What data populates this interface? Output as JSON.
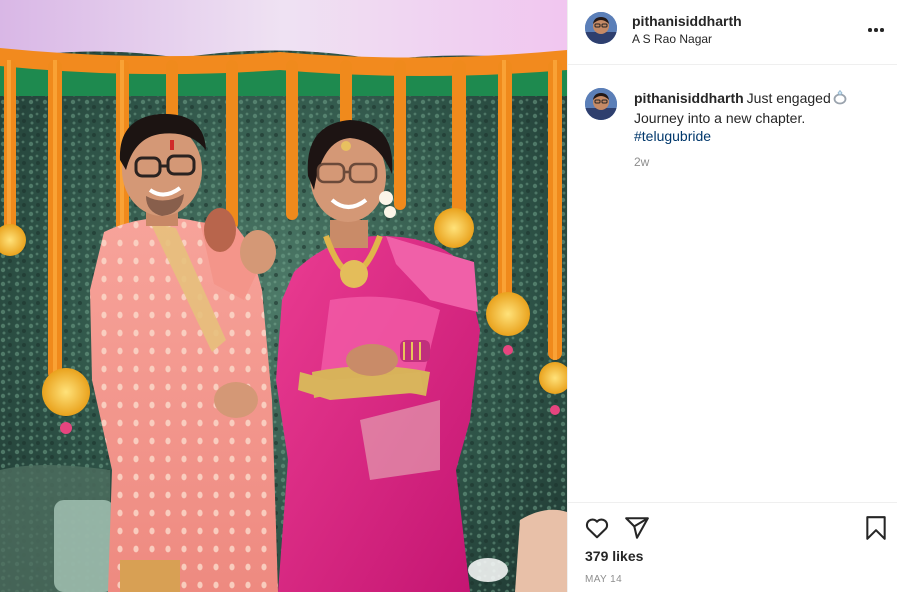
{
  "post": {
    "username": "pithanisiddharth",
    "location": "A S Rao Nagar",
    "caption_line1": "Just engaged",
    "caption_line2": "Journey into a new chapter.",
    "hashtag": "#telugubride",
    "age": "2w",
    "likes": "379 likes",
    "date": "MAY 14"
  },
  "icons": {
    "more": "more-options-icon",
    "ring": "ring-emoji-icon",
    "like": "heart-icon",
    "share": "paper-plane-icon",
    "save": "bookmark-icon"
  },
  "colors": {
    "text": "#262626",
    "secondary": "#8e8e8e",
    "link": "#00376b",
    "border": "#efefef"
  },
  "photo": {
    "description_alt": "Engagement photo"
  }
}
